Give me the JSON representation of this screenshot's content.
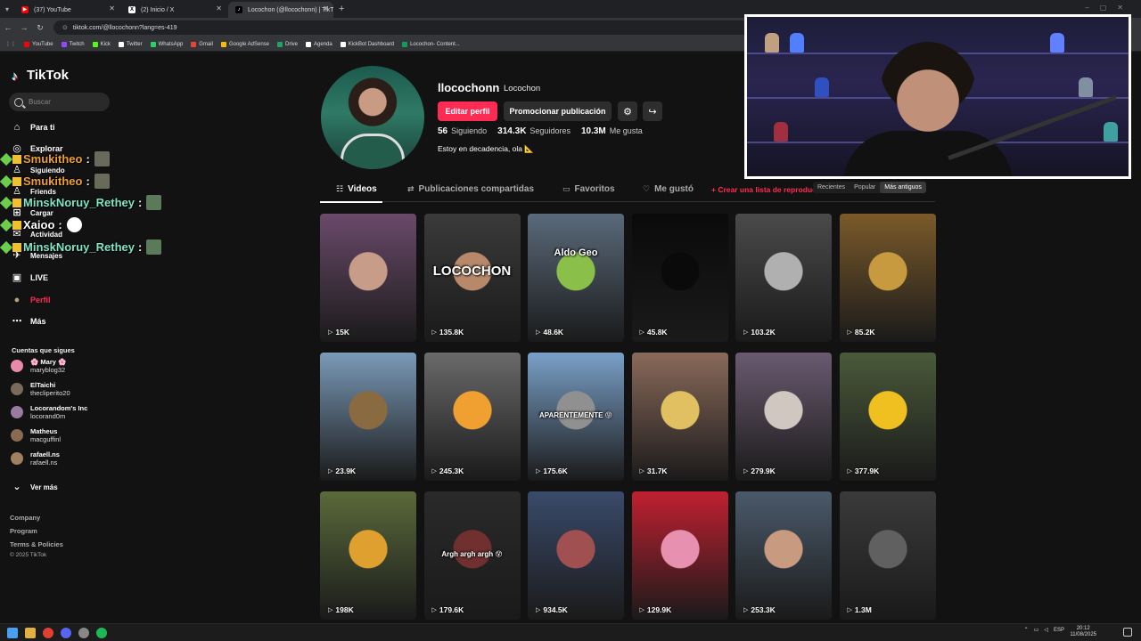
{
  "browser": {
    "tabs": [
      {
        "title": "(37) YouTube",
        "icon": "youtube-icon",
        "color": "#ff0000",
        "glyph": "▶"
      },
      {
        "title": "(2) Inicio / X",
        "icon": "x-icon",
        "color": "#ffffff",
        "glyph": "X"
      },
      {
        "title": "Locochon (@llocochonn) | TikTo",
        "icon": "tiktok-icon",
        "color": "#000000",
        "glyph": "♪"
      }
    ],
    "url": "tiktok.com/@llocochonn?lang=es-419",
    "bookmarks": [
      {
        "label": "YouTube",
        "color": "#ff0000"
      },
      {
        "label": "Twitch",
        "color": "#9146ff"
      },
      {
        "label": "Kick",
        "color": "#53fc18"
      },
      {
        "label": "Twitter",
        "color": "#ffffff"
      },
      {
        "label": "WhatsApp",
        "color": "#25d366"
      },
      {
        "label": "Gmail",
        "color": "#ea4335"
      },
      {
        "label": "Google AdSense",
        "color": "#fbbc04"
      },
      {
        "label": "Drive",
        "color": "#1fa463"
      },
      {
        "label": "Agenda",
        "color": "#ffffff"
      },
      {
        "label": "KickBot Dashboard",
        "color": "#ffffff"
      },
      {
        "label": "Locochon- Content...",
        "color": "#0f9d58"
      }
    ]
  },
  "sidebar": {
    "logo": "TikTok",
    "search_placeholder": "Buscar",
    "nav": [
      {
        "label": "Para ti",
        "icon": "home-icon"
      },
      {
        "label": "Explorar",
        "icon": "compass-icon"
      },
      {
        "label": "Siguiendo",
        "icon": "following-icon"
      },
      {
        "label": "Friends",
        "icon": "friends-icon"
      },
      {
        "label": "Cargar",
        "icon": "upload-icon"
      },
      {
        "label": "Actividad",
        "icon": "activity-icon"
      },
      {
        "label": "Mensajes",
        "icon": "messages-icon"
      },
      {
        "label": "LIVE",
        "icon": "live-icon"
      },
      {
        "label": "Perfil",
        "icon": "profile-icon"
      },
      {
        "label": "Más",
        "icon": "more-icon"
      }
    ],
    "following_title": "Cuentas que sigues",
    "following": [
      {
        "name": "🌸 Mary 🌸",
        "handle": "maryblog32",
        "color": "#e88aa8"
      },
      {
        "name": "ElTaichi",
        "handle": "thecliperito20",
        "color": "#7a6a5a"
      },
      {
        "name": "Locorandom's Inc",
        "handle": "locorand0m",
        "color": "#9a7aa0"
      },
      {
        "name": "Matheus",
        "handle": "macguffinl",
        "color": "#8a6a50"
      },
      {
        "name": "rafaell.ns",
        "handle": "rafaell.ns",
        "color": "#a08060"
      }
    ],
    "see_more": "Ver más",
    "footer": [
      "Company",
      "Program",
      "Terms & Policies"
    ],
    "copyright": "© 2025 TikTok"
  },
  "chat": [
    {
      "user": "Smukitheo",
      "sep": ":",
      "color": "#f0a030"
    },
    {
      "user": "Smukitheo",
      "sep": ":",
      "color": "#f0a030"
    },
    {
      "user": "MinskNoruy_Rethey",
      "sep": ":",
      "color": "#7de8c8"
    },
    {
      "user": "Xaioo",
      "sep": ":",
      "color": "#ffffff"
    },
    {
      "user": "MinskNoruy_Rethey",
      "sep": ":",
      "color": "#7de8c8"
    }
  ],
  "profile": {
    "username": "llocochonn",
    "nickname": "Locochon",
    "edit_label": "Editar perfil",
    "promo_label": "Promocionar publicación",
    "stats": [
      {
        "num": "56",
        "label": "Siguiendo"
      },
      {
        "num": "314.3K",
        "label": "Seguidores"
      },
      {
        "num": "10.3M",
        "label": "Me gusta"
      }
    ],
    "bio": "Estoy en decadencia, ola 📐",
    "tabs": [
      {
        "label": "Videos",
        "icon": "grid-icon"
      },
      {
        "label": "Publicaciones compartidas",
        "icon": "repost-icon"
      },
      {
        "label": "Favoritos",
        "icon": "bookmark-icon"
      },
      {
        "label": "Me gustó",
        "icon": "heart-icon"
      }
    ],
    "playlist_label": "+ Crear una lista de reproducción",
    "sort": [
      "Recientes",
      "Popular",
      "Más antiguos"
    ]
  },
  "videos": [
    {
      "views": "15K",
      "bg": "#6a4a6a",
      "text": "",
      "alt": "#c79d8a"
    },
    {
      "views": "135.8K",
      "bg": "#3a3a3a",
      "text": "LOCOCHON",
      "alt": "#b8886a"
    },
    {
      "views": "48.6K",
      "bg": "#5a6a7a",
      "text": "Aldo Geo",
      "alt": "#8abf4a"
    },
    {
      "views": "45.8K",
      "bg": "#0a0a0a",
      "text": "",
      "alt": "#0a0a0a"
    },
    {
      "views": "103.2K",
      "bg": "#4a4a4a",
      "text": "",
      "alt": "#b0b0b0"
    },
    {
      "views": "85.2K",
      "bg": "#7a5a2a",
      "text": "",
      "alt": "#c89a40"
    },
    {
      "views": "23.9K",
      "bg": "#7a9ab8",
      "text": "",
      "alt": "#8a6a40"
    },
    {
      "views": "245.3K",
      "bg": "#6a6a6a",
      "text": "",
      "alt": "#f0a030"
    },
    {
      "views": "175.6K",
      "bg": "#7aa0c8",
      "text": "APARENTEMENTE 😝",
      "alt": "#909090"
    },
    {
      "views": "31.7K",
      "bg": "#8a6a5a",
      "text": "",
      "alt": "#e0c060"
    },
    {
      "views": "279.9K",
      "bg": "#6a5a70",
      "text": "",
      "alt": "#d0c8c0"
    },
    {
      "views": "377.9K",
      "bg": "#4a5a3a",
      "text": "",
      "alt": "#f0c020"
    },
    {
      "views": "198K",
      "bg": "#5a6a3a",
      "text": "",
      "alt": "#e0a030"
    },
    {
      "views": "179.6K",
      "bg": "#2a2a2a",
      "text": "Argh argh argh 😵",
      "alt": "#703030"
    },
    {
      "views": "934.5K",
      "bg": "#3a4a6a",
      "text": "",
      "alt": "#a05050"
    },
    {
      "views": "129.9K",
      "bg": "#c02030",
      "text": "",
      "alt": "#e890b0"
    },
    {
      "views": "253.3K",
      "bg": "#4a5a6a",
      "text": "",
      "alt": "#c89a80"
    },
    {
      "views": "1.3M",
      "bg": "#3a3a3a",
      "text": "",
      "alt": "#606060"
    }
  ],
  "taskbar": {
    "lang": "ESP",
    "time": "20:12",
    "date": "11/08/2025"
  }
}
